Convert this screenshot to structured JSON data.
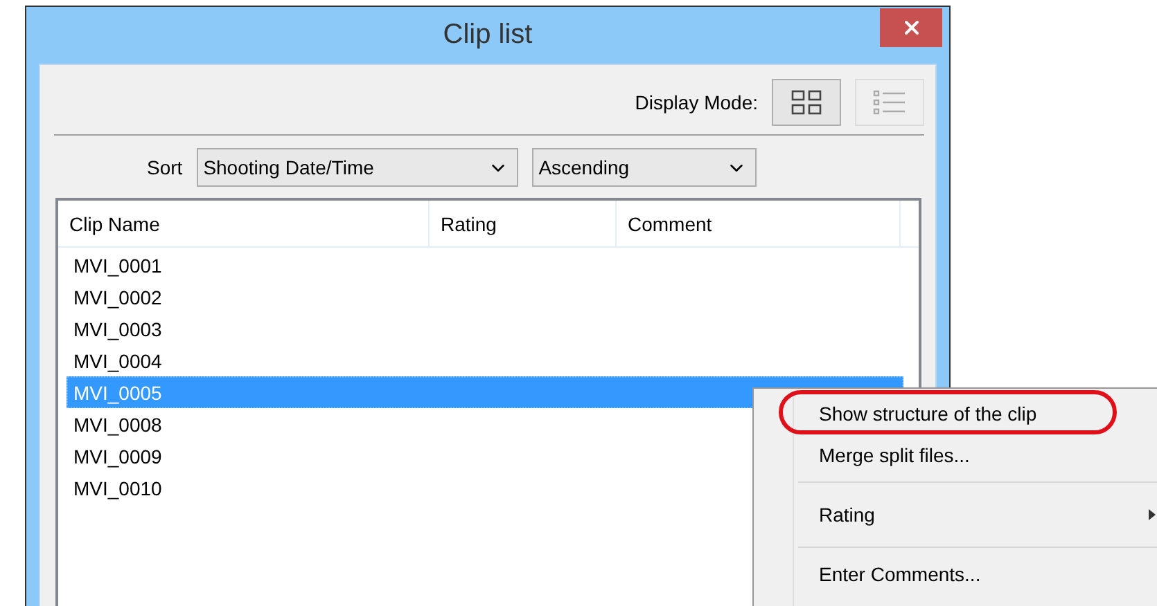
{
  "window": {
    "title": "Clip list"
  },
  "display_mode": {
    "label": "Display Mode:",
    "options": [
      {
        "kind": "thumbnails",
        "selected": true
      },
      {
        "kind": "list",
        "selected": false
      }
    ]
  },
  "sort": {
    "label": "Sort",
    "key": "Shooting Date/Time",
    "order": "Ascending"
  },
  "table": {
    "columns": [
      "Clip Name",
      "Rating",
      "Comment"
    ],
    "rows": [
      {
        "name": "MVI_0001",
        "selected": false
      },
      {
        "name": "MVI_0002",
        "selected": false
      },
      {
        "name": "MVI_0003",
        "selected": false
      },
      {
        "name": "MVI_0004",
        "selected": false
      },
      {
        "name": "MVI_0005",
        "selected": true
      },
      {
        "name": "MVI_0008",
        "selected": false
      },
      {
        "name": "MVI_0009",
        "selected": false
      },
      {
        "name": "MVI_0010",
        "selected": false
      }
    ]
  },
  "context_menu": {
    "items": [
      {
        "kind": "item",
        "label": "Show structure of the clip",
        "annotated": true
      },
      {
        "kind": "item",
        "label": "Merge split files...",
        "annotated": false
      },
      {
        "kind": "separator"
      },
      {
        "kind": "submenu",
        "label": "Rating",
        "annotated": false
      },
      {
        "kind": "separator"
      },
      {
        "kind": "item",
        "label": "Enter Comments...",
        "annotated": false
      }
    ]
  }
}
